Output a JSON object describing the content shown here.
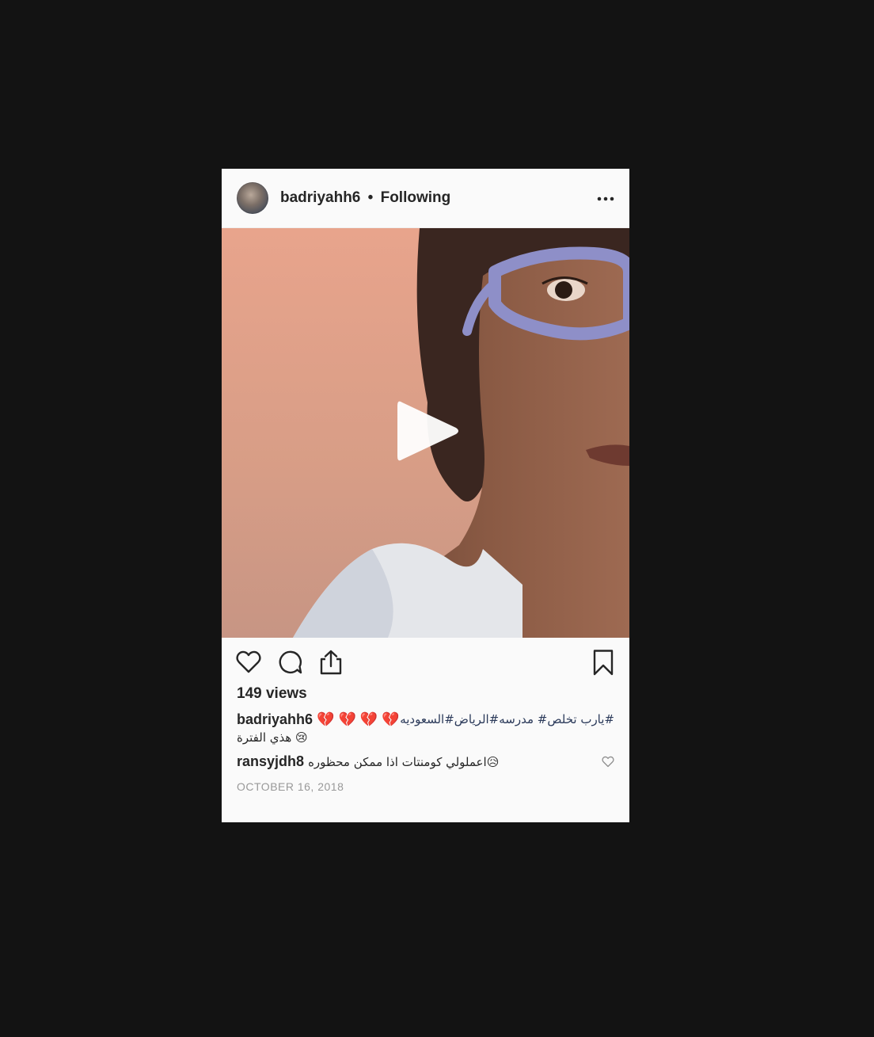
{
  "post": {
    "username": "badriyahh6",
    "separator": "•",
    "follow_status": "Following",
    "more_icon": "more-horizontal-icon",
    "media_type": "video",
    "play_icon": "play-icon",
    "views": "149 views",
    "caption": {
      "username": "badriyahh6",
      "emojis": "💔 💔 💔 💔",
      "hashtags": "#يارب تخلص#  مدرسه#الرياض#السعوديه",
      "line2": "هذي الفترة 😢"
    },
    "comment": {
      "username": "ransyjdh8",
      "text": "اعملولي كومنتات اذا ممكن محظوره😥"
    },
    "date": "OCTOBER 16, 2018"
  },
  "icons": {
    "like": "heart-icon",
    "comment": "comment-icon",
    "share": "share-icon",
    "save": "bookmark-icon"
  },
  "colors": {
    "page_background": "#131313",
    "card_background": "#fafafa",
    "text": "#262626",
    "hashtag": "#2b3a5a",
    "date": "#999999"
  }
}
